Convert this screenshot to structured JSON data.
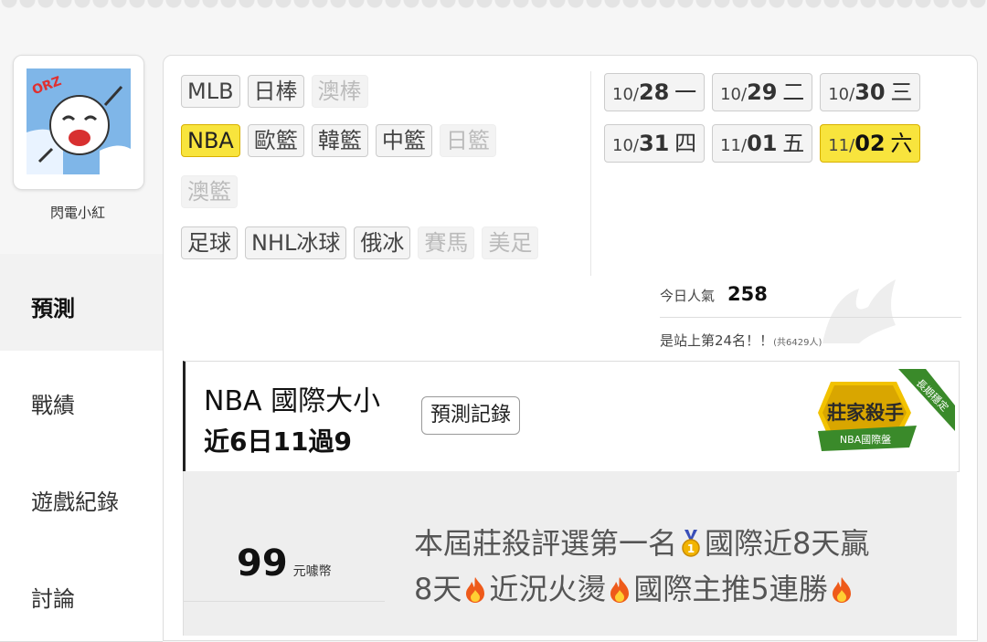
{
  "profile": {
    "username": "閃電小紅"
  },
  "sidebar": {
    "items": [
      {
        "label": "預測",
        "active": true
      },
      {
        "label": "戰績",
        "active": false
      },
      {
        "label": "遊戲紀錄",
        "active": false
      },
      {
        "label": "討論",
        "active": false
      }
    ]
  },
  "leagues": {
    "rows": [
      [
        {
          "label": "MLB",
          "state": "normal"
        },
        {
          "label": "日棒",
          "state": "normal"
        },
        {
          "label": "澳棒",
          "state": "disabled"
        }
      ],
      [
        {
          "label": "NBA",
          "state": "selected"
        },
        {
          "label": "歐籃",
          "state": "normal"
        },
        {
          "label": "韓籃",
          "state": "normal"
        },
        {
          "label": "中籃",
          "state": "normal"
        },
        {
          "label": "日籃",
          "state": "disabled"
        }
      ],
      [
        {
          "label": "澳籃",
          "state": "disabled"
        }
      ],
      [
        {
          "label": "足球",
          "state": "normal"
        },
        {
          "label": "NHL冰球",
          "state": "normal"
        },
        {
          "label": "俄冰",
          "state": "normal"
        },
        {
          "label": "賽馬",
          "state": "disabled"
        },
        {
          "label": "美足",
          "state": "disabled"
        }
      ]
    ]
  },
  "dates": {
    "rows": [
      [
        {
          "month": "10/",
          "day": "28",
          "weekday": "一",
          "selected": false
        },
        {
          "month": "10/",
          "day": "29",
          "weekday": "二",
          "selected": false
        },
        {
          "month": "10/",
          "day": "30",
          "weekday": "三",
          "selected": false
        }
      ],
      [
        {
          "month": "10/",
          "day": "31",
          "weekday": "四",
          "selected": false
        },
        {
          "month": "11/",
          "day": "01",
          "weekday": "五",
          "selected": false
        },
        {
          "month": "11/",
          "day": "02",
          "weekday": "六",
          "selected": true
        }
      ]
    ]
  },
  "stats": {
    "popularity_label": "今日人氣",
    "popularity_value": "258",
    "rank_text": "是站上第24名！！",
    "rank_total": "(共6429人)"
  },
  "prediction": {
    "title": "NBA 國際大小",
    "subtitle": "近6日11過9",
    "record_button": "預測記錄",
    "badge_main": "莊家殺手",
    "badge_sub": "NBA國際盤",
    "badge_ribbon": "長期穩定",
    "price_value": "99",
    "price_unit": "元噱幣",
    "desc_line1_a": "本屆莊殺評選第一名",
    "desc_line1_b": "國際近8天贏",
    "desc_line2_a": "8天",
    "desc_line2_b": "近況火燙",
    "desc_line2_c": "國際主推5連勝"
  },
  "colors": {
    "selected": "#f8e43d",
    "badge_green": "#3a8a2a",
    "badge_gold": "#e6b800"
  }
}
